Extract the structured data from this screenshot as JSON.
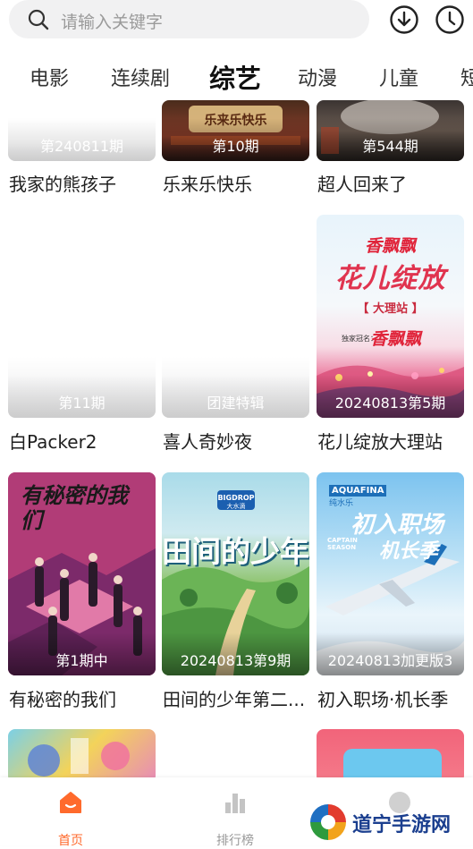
{
  "search": {
    "placeholder": "请输入关键字"
  },
  "header_icons": [
    "download-icon",
    "history-clock-icon"
  ],
  "tabs": [
    {
      "label": "电影"
    },
    {
      "label": "连续剧"
    },
    {
      "label": "综艺",
      "active": true
    },
    {
      "label": "动漫"
    },
    {
      "label": "儿童"
    },
    {
      "label": "短"
    }
  ],
  "cards": [
    {
      "title": "我家的熊孩子",
      "episode": "第240811期"
    },
    {
      "title": "乐来乐快乐",
      "episode": "第10期",
      "poster_text": "乐来乐快乐"
    },
    {
      "title": "超人回来了",
      "episode": "第544期"
    },
    {
      "title": "白Packer2",
      "episode": "第11期"
    },
    {
      "title": "喜人奇妙夜",
      "episode": "团建特辑"
    },
    {
      "title": "花儿绽放大理站",
      "episode": "20240813第5期",
      "poster_brand": "香飘飘",
      "poster_main": "花儿绽放",
      "poster_sub": "【 大理站 】",
      "poster_sponsor_label": "独家冠名：",
      "poster_sponsor": "香飘飘"
    },
    {
      "title": "有秘密的我们",
      "episode": "第1期中",
      "poster_text": "有秘密的我们"
    },
    {
      "title": "田间的少年第二...",
      "episode": "20240813第9期",
      "poster_brand": "BIGDROP",
      "poster_brand_sub": "大水滴",
      "poster_main": "田间的少年"
    },
    {
      "title": "初入职场·机长季",
      "episode": "20240813加更版3",
      "poster_brand": "AQUAFINA",
      "poster_brand_sub": "纯水乐",
      "poster_main": "初入职场",
      "poster_main2": "机长季",
      "poster_sub": "CAPTAIN SEASON"
    }
  ],
  "bottom_nav": [
    {
      "label": "首页",
      "active": true,
      "icon": "home-icon"
    },
    {
      "label": "排行榜",
      "icon": "bar-chart-icon"
    },
    {
      "label": "",
      "icon": "user-icon"
    }
  ],
  "watermark": {
    "text": "道宁手游网"
  },
  "colors": {
    "accent": "#ff6a2c",
    "nav_inactive": "#999999"
  }
}
